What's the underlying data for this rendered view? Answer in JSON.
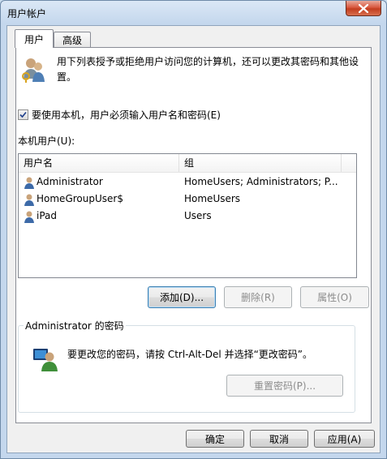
{
  "window": {
    "title": "用户帐户"
  },
  "tabs": [
    {
      "label": "用户",
      "active": true
    },
    {
      "label": "高级",
      "active": false
    }
  ],
  "intro": {
    "text": "用下列表授予或拒绝用户访问您的计算机，还可以更改其密码和其他设置。"
  },
  "checkbox": {
    "label": "要使用本机，用户必须输入用户名和密码(E)",
    "checked": true
  },
  "users_section": {
    "label": "本机用户(U):"
  },
  "table": {
    "columns": [
      "用户名",
      "组"
    ],
    "rows": [
      {
        "name": "Administrator",
        "group": "HomeUsers; Administrators; P..."
      },
      {
        "name": "HomeGroupUser$",
        "group": "HomeUsers"
      },
      {
        "name": "iPad",
        "group": "Users"
      }
    ]
  },
  "buttons": {
    "add": "添加(D)...",
    "remove": "删除(R)",
    "properties": "属性(O)"
  },
  "password_group": {
    "title": "Administrator 的密码",
    "text": "要更改您的密码，请按 Ctrl-Alt-Del 并选择“更改密码”。",
    "reset_button": "重置密码(P)..."
  },
  "footer": {
    "ok": "确定",
    "cancel": "取消",
    "apply": "应用(A)"
  }
}
